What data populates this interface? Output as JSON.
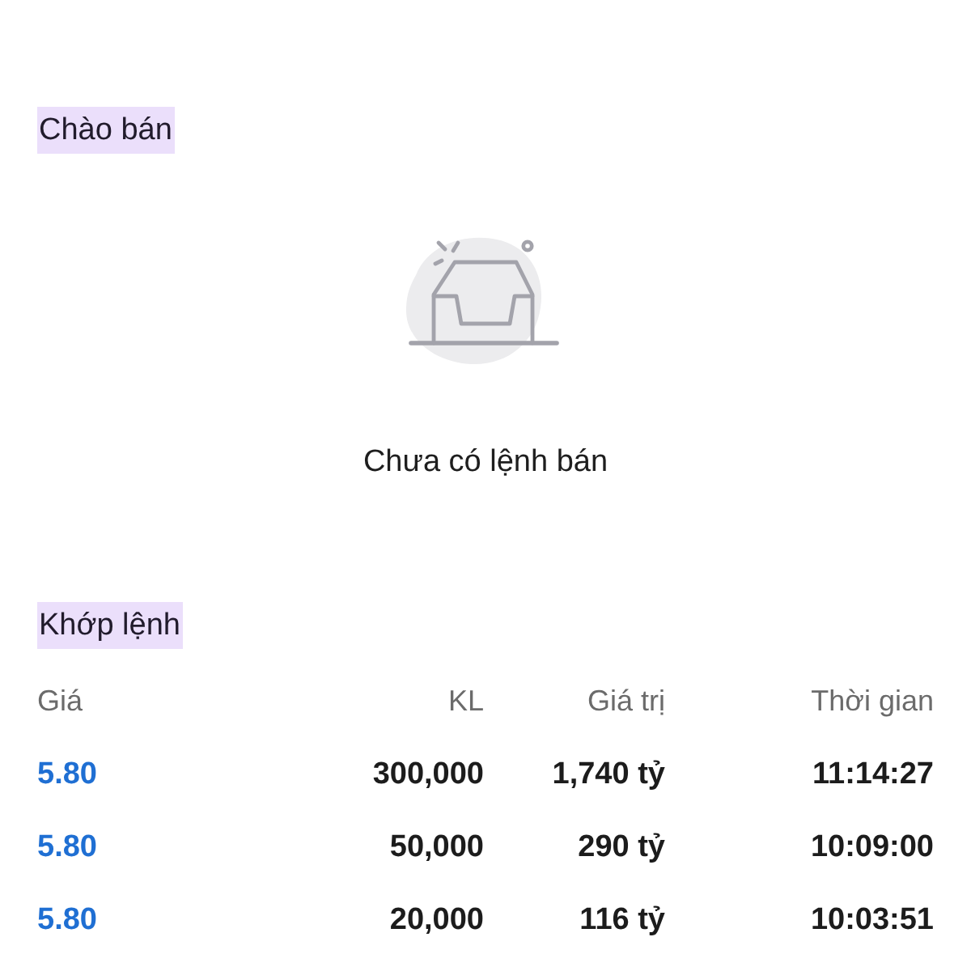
{
  "offer_section": {
    "title": "Chào bán",
    "empty_message": "Chưa có lệnh bán"
  },
  "matched_section": {
    "title": "Khớp lệnh",
    "table": {
      "columns": [
        "Giá",
        "KL",
        "Giá trị",
        "Thời gian"
      ],
      "rows": [
        {
          "price": "5.80",
          "volume": "300,000",
          "value": "1,740 tỷ",
          "time": "11:14:27"
        },
        {
          "price": "5.80",
          "volume": "50,000",
          "value": "290 tỷ",
          "time": "10:09:00"
        },
        {
          "price": "5.80",
          "volume": "20,000",
          "value": "116 tỷ",
          "time": "10:03:51"
        }
      ]
    }
  }
}
